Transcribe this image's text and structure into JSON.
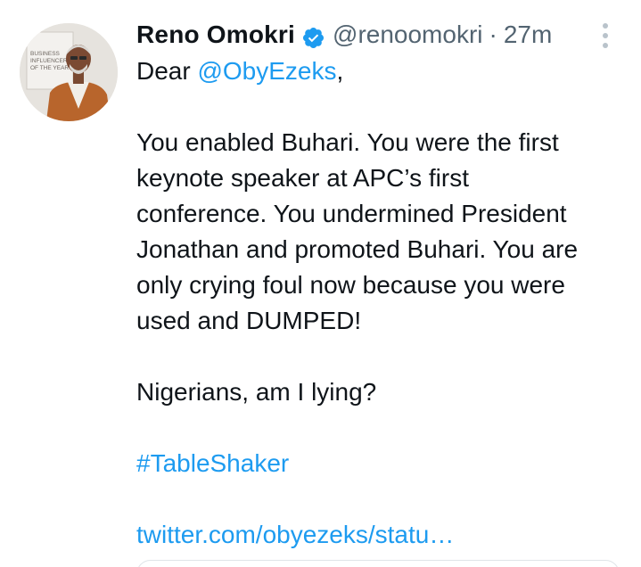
{
  "tweet": {
    "author": {
      "display_name": "Reno Omokri",
      "verified": true,
      "handle": "@renoomokri",
      "separator": "·",
      "time": "27m",
      "avatar_icon": "profile-photo",
      "avatar_poster_text": [
        "BUSINESS",
        "INFLUENCER",
        "OF THE YEAR"
      ]
    },
    "more_icon": "more-vertical-icon",
    "greeting_prefix": "Dear ",
    "mention": "@ObyEzeks",
    "greeting_suffix": ",",
    "paragraph_lines": [
      "You enabled Buhari. You were the first",
      "keynote speaker at APC’s first",
      "conference. You undermined President",
      "Jonathan and promoted Buhari. You are",
      "only crying foul now because you were",
      "used and DUMPED!"
    ],
    "question": "Nigerians, am I lying?",
    "hashtag": "#TableShaker",
    "link_text": "twitter.com/obyezeks/statu…",
    "colors": {
      "link": "#1d9bf0",
      "verified": "#1d9bf0",
      "muted": "#536471"
    }
  }
}
